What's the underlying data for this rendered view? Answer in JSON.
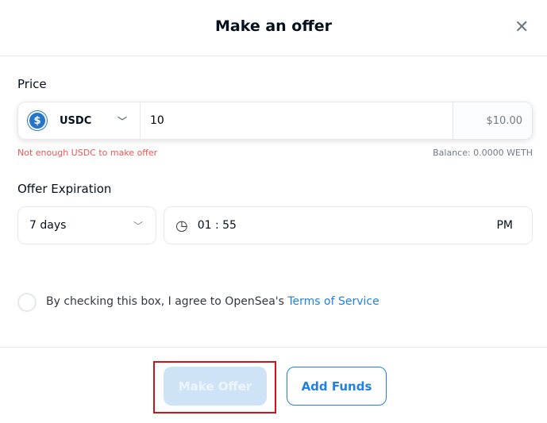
{
  "dialog": {
    "title": "Make an offer",
    "close_icon": "close-icon"
  },
  "price": {
    "label": "Price",
    "currency": "USDC",
    "amount": "10",
    "usd_value": "$10.00",
    "error": "Not enough USDC to make offer",
    "balance": "Balance: 0.0000 WETH"
  },
  "expiration": {
    "label": "Offer Expiration",
    "duration": "7 days",
    "time": "01 : 55",
    "ampm": "PM"
  },
  "terms": {
    "text": "By checking this box, I agree to OpenSea's ",
    "link": "Terms of Service",
    "checked": false
  },
  "buttons": {
    "make_offer": "Make Offer",
    "add_funds": "Add Funds"
  },
  "colors": {
    "accent": "#2081e2",
    "error": "#eb5757",
    "highlight": "#d0121b"
  }
}
